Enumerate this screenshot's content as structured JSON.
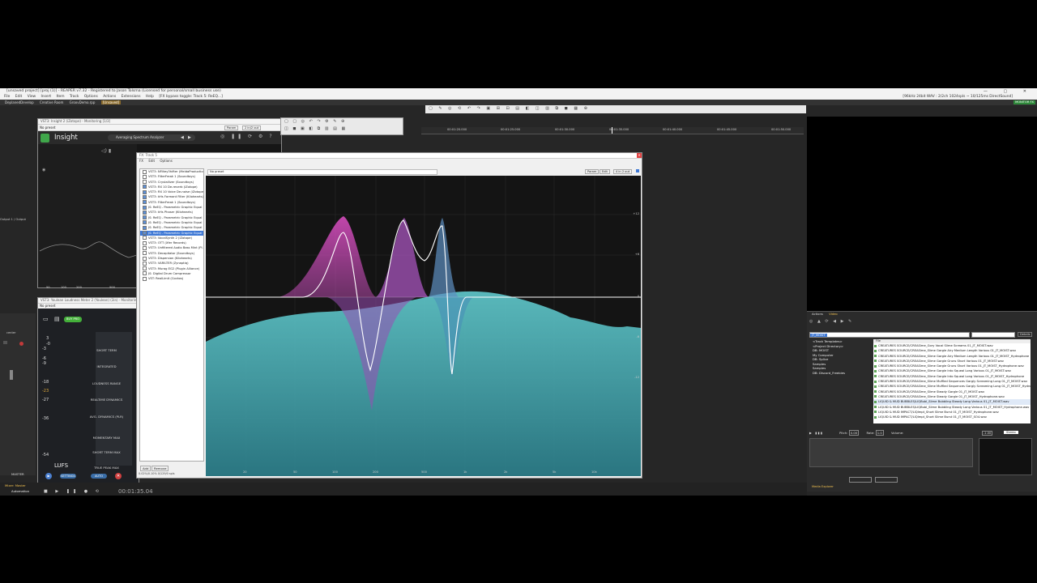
{
  "window": {
    "title": "[unsaved project] [proj (1)] - REAPER v7.32 - Registered to Jason Tolsma (Licensed for personal/small business use)",
    "status_right": "[96kHz 24bit WAV : 2/2ch 1024spls ~ 10/125ms DirectSound]",
    "monitor_badge": "MONITOR FX"
  },
  "menubar": {
    "items": [
      "File",
      "Edit",
      "View",
      "Insert",
      "Item",
      "Track",
      "Options",
      "Actions",
      "Extensions",
      "Help"
    ],
    "fx_note": "[FX bypass toggle: Track 5: ReEQ...]"
  },
  "tabs": [
    "DeplanedDevelop",
    "Creative Room",
    "GroovDemo.rpp",
    "[Unsaved]"
  ],
  "insight": {
    "title": "VST3: Insight 2 (iZotope) - Monitoring [1/3]",
    "preset": "No preset",
    "param_label": "Param",
    "io_label": "2 in/2 out",
    "brand": "Insight",
    "analyzer_label": "Averaging Spectrum Analyzer",
    "freq_ticks": [
      "50",
      "100",
      "200",
      "500"
    ],
    "side_label": "Output 1 / Output"
  },
  "loudness": {
    "title": "VST3: Youlean Loudness Meter 2 (Youlean) (3in) - Monitoring [2/3]",
    "preset": "No preset",
    "buy_label": "BUY PRO",
    "scale": [
      "3",
      "-3",
      "-3",
      "-6",
      "-9",
      "-18",
      "-23",
      "-27",
      "-36",
      "-54"
    ],
    "labels": [
      "SHORT TERM",
      "INTEGRATED",
      "LOUDNESS RANGE",
      "REALTIME DYNAMICS",
      "AVG. DYNAMICS (PLR)",
      "MOMENTARY MAX",
      "SHORT TERM MAX",
      "TRUE PEAK MAX"
    ],
    "unit": "LUFS",
    "btn_set": "SETTINGS",
    "btn_auto": "AUTO"
  },
  "fx_window": {
    "title": "FX: Track 5",
    "menu": [
      "FX",
      "Edit",
      "Options"
    ],
    "preset": "No preset",
    "param_label": "Param",
    "edit_label": "Edit",
    "io_label": "4 in 2 out",
    "add_label": "Add",
    "remove_label": "Remove",
    "footer": "0.02%/0.10% 0/129/0 spls",
    "plugins": [
      {
        "name": "VST3: NFiltey3hifter (MeldaProduction)",
        "checked": false
      },
      {
        "name": "VST3: FilterFreak 1 (Soundtoys)",
        "checked": false
      },
      {
        "name": "VST3: Crystallizer (Soundtoys)",
        "checked": false
      },
      {
        "name": "VST3: RX 10 De-reverb (iZotope)",
        "checked": true
      },
      {
        "name": "VST3: RX 10 Voice De-noise (iZotope)",
        "checked": true
      },
      {
        "name": "VST3: kHs Formant Filter (Kilohearts)",
        "checked": true
      },
      {
        "name": "VST3: FilterFreak 1 (Soundtoys)",
        "checked": true
      },
      {
        "name": "JS: ReEQ - Parametric Graphic Equal",
        "checked": true
      },
      {
        "name": "VST3: kHs Phaser (Kilohearts)",
        "checked": true
      },
      {
        "name": "JS: ReEQ - Parametric Graphic Equal",
        "checked": true
      },
      {
        "name": "JS: ReEQ - Parametric Graphic Equal",
        "checked": true
      },
      {
        "name": "JS: ReEQ - Parametric Graphic Equal",
        "checked": true
      },
      {
        "name": "JS: ReEQ - Parametric Graphic Equal",
        "checked": true,
        "selected": true
      },
      {
        "name": "VST3: VocalSynth 2 (iZotope)",
        "checked": false
      },
      {
        "name": "VST3: OTT (Xfer Records)",
        "checked": false
      },
      {
        "name": "VST3: Unfiltered Audio Bass Mint (Pl..",
        "checked": false
      },
      {
        "name": "VST3: Decapitator (Soundtoys)",
        "checked": false
      },
      {
        "name": "VST3: Dispersion (Kilohearts)",
        "checked": false
      },
      {
        "name": "VST3: VARILTER (Zynaptiq)",
        "checked": false
      },
      {
        "name": "VST3: Murag EG2 (Plugin Alliance)",
        "checked": false
      },
      {
        "name": "JS: Digital Drum Compressor",
        "checked": false
      },
      {
        "name": "VST: RealLimit (Cockos)",
        "checked": false
      }
    ],
    "freq_ticks": [
      "20",
      "50",
      "100",
      "200",
      "500",
      "1k",
      "2k",
      "5k",
      "10k"
    ],
    "db_ticks": [
      "+12",
      "+6",
      "0",
      "-6",
      "-12"
    ]
  },
  "timeline": {
    "marks": [
      "00:01:20.000",
      "00:01:25.000",
      "00:01:30.000",
      "00:01:35.000",
      "00:01:40.000",
      "00:01:45.000",
      "00:01:50.000"
    ]
  },
  "transport": {
    "time": "00:01:35.04"
  },
  "track_tabs": [
    "Mixer: Master",
    "Automation"
  ],
  "media": {
    "tabs": [
      "Actions",
      "Video"
    ],
    "search": "JT_MOIST",
    "details_label": "Details",
    "tree": [
      "<Track Templates>",
      "<Project Directory>",
      "DB: MOIST",
      "My Computer",
      "DB: Splice",
      "Samples",
      "Samples",
      "DB: Discord_Freebies"
    ],
    "file_header": "File",
    "files": [
      "CREATURES SOURCE/CREASlme_Gory Vocal Slime Screams 01_JT_MOIST.wav",
      "CREATURES SOURCE/CREASlme_Slime Gargle Airy Medium Length Various 01_JT_MOIST.wav",
      "CREATURES SOURCE/CREASlme_Slime Gargle Airy Medium Length Various 01_JT_MOIST_Hydrophone",
      "CREATURES SOURCE/CREASlme_Slime Gargle Gruns Short Various 01_JT_MOIST.wav",
      "CREATURES SOURCE/CREASlme_Slime Gargle Gruns Short Various 01_JT_MOIST_Hydrophone.wav",
      "CREATURES SOURCE/CREASlme_Slime Gargle Into Squeal Long Various 01_JT_MOIST.wav",
      "CREATURES SOURCE/CREASlme_Slime Gargle Into Squeal Long Various 01_JT_MOIST_Hydrophone",
      "CREATURES SOURCE/CREASlme_Slime Muffled Sequences Gargly Screaming Long 01_JT_MOIST.wav",
      "CREATURES SOURCE/CREASlme_Slime Muffled Sequences Gargly Screaming Long 01_JT_MOIST_Hydro",
      "CREATURES SOURCE/CREASlme_Slime Steady Gargle 01_JT_MOIST.wav",
      "CREATURES SOURCE/CREASlme_Slime Steady Gargle 01_JT_MOIST_Hydrophone.wav",
      "LIQUID & MUD BUBBLES/LIQBubl_Slime Bubbling Steady Long Various 01_JT_MOIST.wav",
      "LIQUID & MUD BUBBLES/LIQBubl_Slime Bubbling Steady Long Various 01_JT_MOIST_Hydrophone.wav",
      "LIQUID & MUD IMPACT/LIQImpt_Short Slime Burst 01_JT_MOIST_Hydrophone.wav",
      "LIQUID & MUD IMPACT/LIQImpt_Short Slime Burst 01_JT_MOIST_SO4.wav"
    ],
    "pitch_label": "Pitch:",
    "pitch_value": "0.00",
    "rate_label": "Rate:",
    "rate_value": "1.0",
    "volume_label": "Volume:",
    "volume_value": "-1.00",
    "stereo_label": "Stereo",
    "footer_tab": "Media Explorer"
  },
  "mixer": {
    "master_label": "MASTER",
    "center_label": "center"
  }
}
